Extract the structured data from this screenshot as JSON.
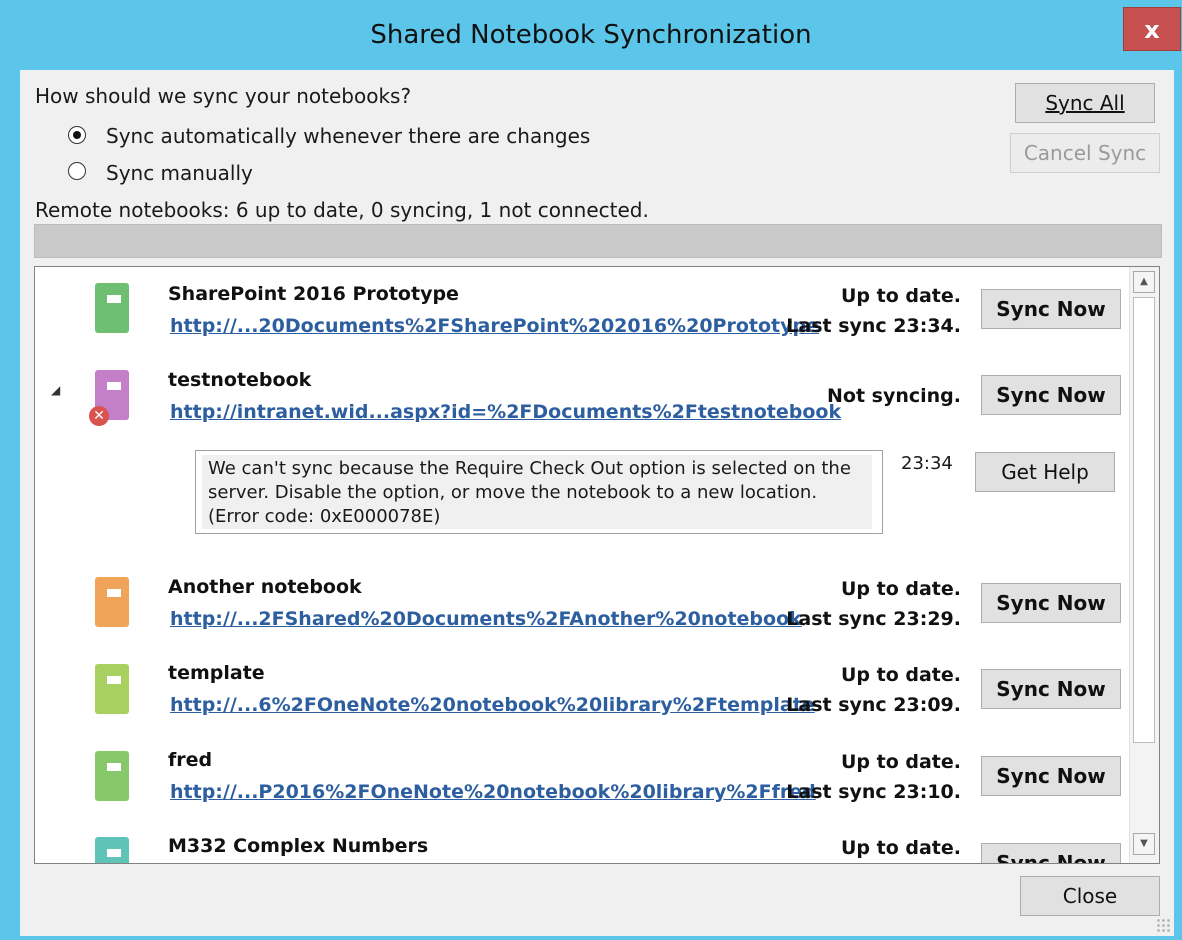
{
  "window": {
    "title": "Shared Notebook Synchronization",
    "close_glyph": "x",
    "close_color": "#c75050",
    "frame_color": "#5cc6ea"
  },
  "sync_options": {
    "question": "How should we sync your notebooks?",
    "auto_label": "Sync automatically whenever there are changes",
    "manual_label": "Sync manually",
    "selected": "auto"
  },
  "buttons": {
    "sync_all": "Sync All",
    "cancel_sync": "Cancel Sync",
    "close": "Close"
  },
  "status_summary": "Remote notebooks: 6 up to date, 0 syncing, 1 not connected.",
  "notebooks": [
    {
      "name": "SharePoint 2016 Prototype",
      "url": "http://...20Documents%2FSharePoint%202016%20Prototype",
      "status": "Up to date.",
      "last_sync": "Last sync 23:34.",
      "button": "Sync Now",
      "color": "#6fbf73"
    },
    {
      "name": "testnotebook",
      "url": "http://intranet.wid...aspx?id=%2FDocuments%2Ftestnotebook",
      "status": "Not syncing.",
      "button": "Sync Now",
      "color": "#c47fc9",
      "error": {
        "message": "We can't sync because the Require Check Out option is selected on the server. Disable the option, or move the notebook to a new location. (Error code: 0xE000078E)",
        "time": "23:34",
        "button": "Get Help"
      }
    },
    {
      "name": "Another notebook",
      "url": "http://...2FShared%20Documents%2FAnother%20notebook",
      "status": "Up to date.",
      "last_sync": "Last sync 23:29.",
      "button": "Sync Now",
      "color": "#f0a45a"
    },
    {
      "name": "template",
      "url": "http://...6%2FOneNote%20notebook%20library%2Ftemplate",
      "status": "Up to date.",
      "last_sync": "Last sync 23:09.",
      "button": "Sync Now",
      "color": "#a8d060"
    },
    {
      "name": "fred",
      "url": "http://...P2016%2FOneNote%20notebook%20library%2Ffred",
      "status": "Up to date.",
      "last_sync": "Last sync 23:10.",
      "button": "Sync Now",
      "color": "#86c86a"
    },
    {
      "name": "M332 Complex Numbers",
      "status": "Up to date.",
      "button": "Sync Now",
      "color": "#5fc3b8"
    }
  ]
}
